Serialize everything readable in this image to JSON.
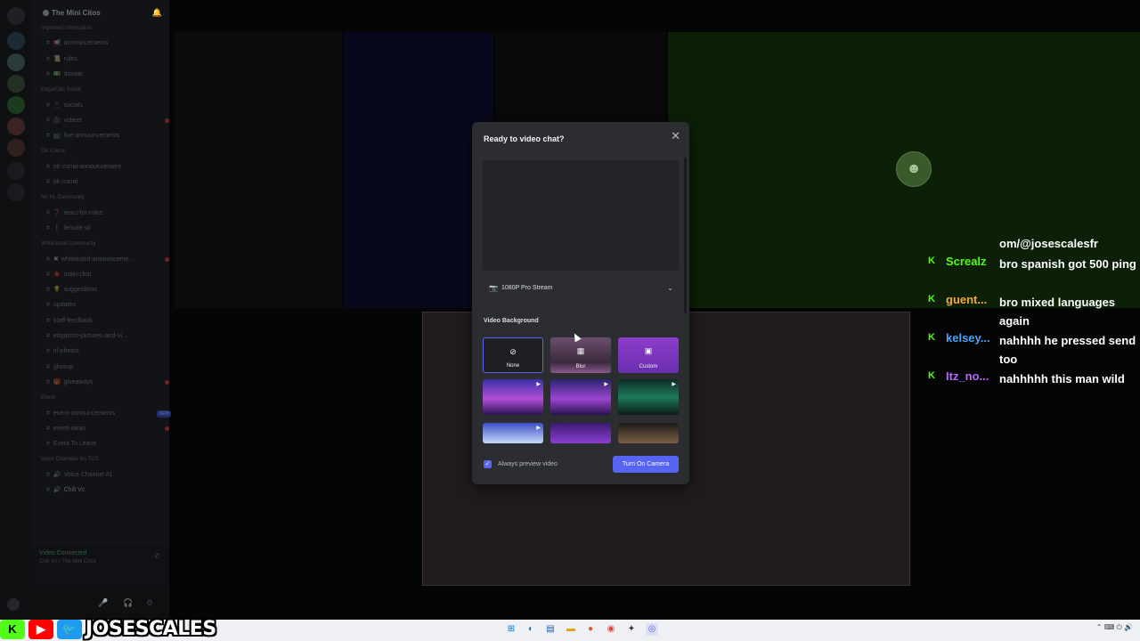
{
  "server": {
    "name": "The Mini Citos",
    "channels": [
      {
        "kind": "cat",
        "label": "Important Information"
      },
      {
        "kind": "ch",
        "icon": "📢",
        "label": "announcements"
      },
      {
        "kind": "ch",
        "icon": "📜",
        "label": "rules"
      },
      {
        "kind": "ch",
        "icon": "💵",
        "label": "donate"
      },
      {
        "kind": "cat",
        "label": "EdgarCito Social"
      },
      {
        "kind": "ch",
        "icon": "📱",
        "label": "socials"
      },
      {
        "kind": "ch",
        "icon": "🎥",
        "label": "videos",
        "dot": true
      },
      {
        "kind": "ch",
        "icon": "📺",
        "label": "live-announcements"
      },
      {
        "kind": "cat",
        "label": "OK Corral"
      },
      {
        "kind": "ch",
        "icon": "",
        "label": "ok-corral-announcement"
      },
      {
        "kind": "ch",
        "icon": "",
        "label": "ok-corral"
      },
      {
        "kind": "cat",
        "label": "No HL Community"
      },
      {
        "kind": "ch",
        "icon": "❓",
        "label": "react-for-roles"
      },
      {
        "kind": "ch",
        "icon": "❗",
        "label": "female-wl"
      },
      {
        "kind": "cat",
        "label": "Whitelisted Community"
      },
      {
        "kind": "ch",
        "icon": "✖",
        "label": "whitelisted-announceme...",
        "dot": true
      },
      {
        "kind": "ch",
        "icon": "🍁",
        "label": "main-chat"
      },
      {
        "kind": "ch",
        "icon": "💡",
        "label": "suggestions"
      },
      {
        "kind": "ch",
        "icon": "",
        "label": "updates"
      },
      {
        "kind": "ch",
        "icon": "",
        "label": "staff-feedback"
      },
      {
        "kind": "ch",
        "icon": "",
        "label": "edgarcito-pictures-and-vi..."
      },
      {
        "kind": "ch",
        "icon": "",
        "label": "irl-photos"
      },
      {
        "kind": "ch",
        "icon": "",
        "label": "glowup"
      },
      {
        "kind": "ch",
        "icon": "🎁",
        "label": "giveaways",
        "dot": true
      },
      {
        "kind": "cat",
        "label": "Event"
      },
      {
        "kind": "ch",
        "icon": "",
        "label": "event-announcements",
        "new": "NEW"
      },
      {
        "kind": "ch",
        "icon": "",
        "label": "event-ideas",
        "dot": true
      },
      {
        "kind": "ch",
        "icon": "",
        "label": "Event To Leave"
      },
      {
        "kind": "cat",
        "label": "Voice Channels No TOS"
      },
      {
        "kind": "ch",
        "icon": "🔊",
        "label": "Voice Channel #1"
      },
      {
        "kind": "ch",
        "icon": "🔊",
        "label": "Chill Vc",
        "sel": true
      }
    ],
    "voice_status": "Video Connected",
    "voice_sub": "Chill Vc / The Mini Citos"
  },
  "modal": {
    "title": "Ready to video chat?",
    "camera": "1080P Pro Stream",
    "background_header": "Video Background",
    "options": {
      "none": "None",
      "blur": "Blur",
      "custom": "Custom"
    },
    "always_preview": "Always preview video",
    "turn_on_camera": "Turn On Camera"
  },
  "chat": [
    {
      "user": "",
      "msg": "om/@josescalesfr",
      "color": "#ffffff"
    },
    {
      "user": "Screalz",
      "msg": "bro spanish got 500 ping",
      "color": "#53fc18"
    },
    {
      "user": "guent...",
      "msg": "bro mixed languages again",
      "color": "#f2a93b"
    },
    {
      "user": "kelsey...",
      "msg": "nahhhh he pressed send too",
      "color": "#4aa3ff"
    },
    {
      "user": "Itz_no...",
      "msg": "nahhhhh this man wild",
      "color": "#b368ff"
    }
  ],
  "banner": {
    "streamer": "JOSESCALES",
    "kick": "K",
    "youtube": "▶",
    "twitter": "🐦"
  },
  "colors": {
    "accent": "#5865f2",
    "kick_green": "#53fc18"
  }
}
